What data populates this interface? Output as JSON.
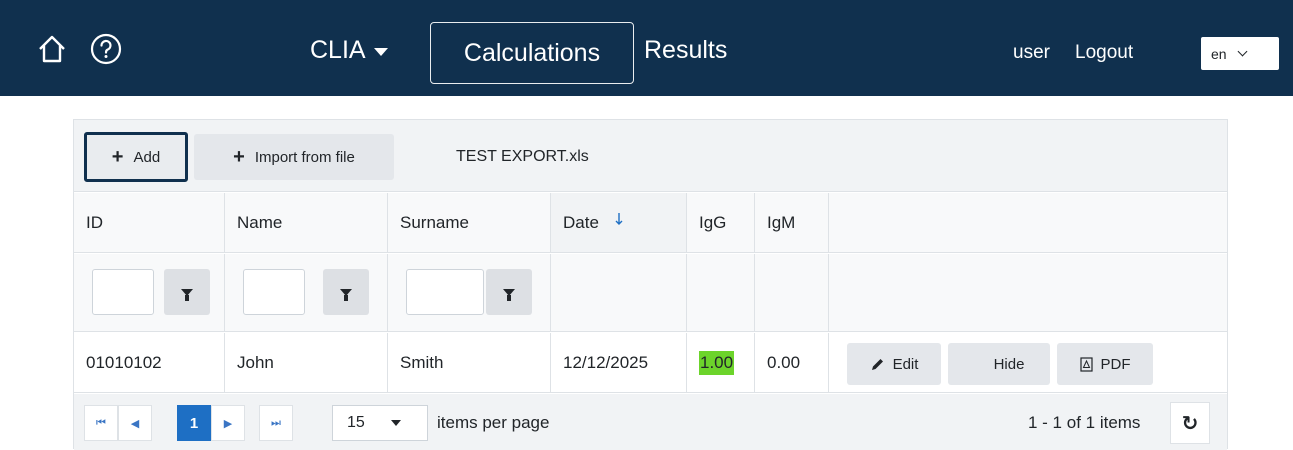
{
  "nav": {
    "module": "CLIA",
    "calculations": "Calculations",
    "results": "Results",
    "user": "user",
    "logout": "Logout",
    "language": "en",
    "icons": [
      "home-icon",
      "help-icon"
    ],
    "bg_color": "#10304e"
  },
  "toolbar": {
    "add_label": "Add",
    "import_label": "Import from file",
    "filename": "TEST EXPORT.xls"
  },
  "columns": [
    "ID",
    "Name",
    "Surname",
    "Date",
    "IgG",
    "IgM"
  ],
  "sort": {
    "column": "Date",
    "direction": "descending"
  },
  "rows": [
    {
      "id": "01010102",
      "name": "John",
      "surname": "Smith",
      "date": "12/12/2025",
      "igg": "1.00",
      "igm": "0.00"
    }
  ],
  "row_actions": {
    "edit": "Edit",
    "hide": "Hide",
    "pdf": "PDF"
  },
  "highlight_color": "#6cd42b",
  "pager": {
    "current_page": "1",
    "page_size": "15",
    "items_per_page_label": "items per page",
    "info": "1 - 1 of 1 items"
  }
}
